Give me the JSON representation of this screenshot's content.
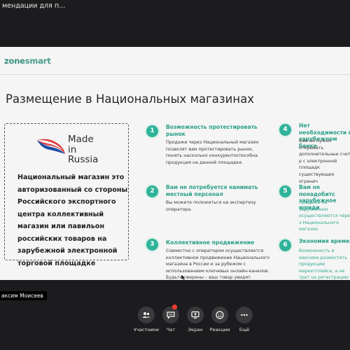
{
  "window": {
    "title": "мендации для п..."
  },
  "slide": {
    "logo": {
      "prefix": "zone",
      "suffix": "smart"
    },
    "headline": "Размещение в Национальных магазинах",
    "made_in_russia": {
      "line1": "Made",
      "line2": "in Russia"
    },
    "national_store_text": "Национальный магазин это авторизованный со стороны Российского экспортного центра коллективный магазин или павильон российских товаров на зарубежной электронной торговой площадке",
    "features": [
      {
        "num": "1",
        "title": "Возможность протестировать рынок",
        "text": "Продажи через Национальный магазин позволят вам протестировать рынок, понять насколько конкурентоспособна продукция на данной площадке."
      },
      {
        "num": "2",
        "title": "Вам не потребуется нанимать местный персонал",
        "text": "Вы можете положиться на экспертизу оператора."
      },
      {
        "num": "3",
        "title": "Коллективное продвижение",
        "text": "Совместно с оператором осуществляется коллективное продвижение Национального магазина в России и за рубежом с использованием ключевых онлайн-каналов. Будьте уверены – ваш товар увидят."
      },
      {
        "num": "4",
        "title": "Нет необходимости в зарубежном банке",
        "text": "Вам не нужно открывать дополнительные счета р с электронной площадк существующих огранич"
      },
      {
        "num": "5",
        "title": "Вам не понадобитс зарубежное юриди",
        "text": "Продажи на зарубежном осуществляются через з Национального магазин"
      },
      {
        "num": "6",
        "title": "Экономия времен",
        "text": "Возможность в максима разместить продукцию маркетплейсе, а не трат на регистрацию собстве подготовку необходим"
      }
    ]
  },
  "participant": {
    "name": "аксим Моисеев"
  },
  "toolbar": [
    {
      "label": "Участники",
      "icon": "people-icon"
    },
    {
      "label": "Чат",
      "icon": "chat-icon"
    },
    {
      "label": "Экран",
      "icon": "screen-share-icon"
    },
    {
      "label": "Реакции",
      "icon": "smile-icon"
    },
    {
      "label": "Ещё",
      "icon": "more-icon"
    }
  ],
  "colors": {
    "accent": "#2fb39a",
    "background": "#1c1c1e",
    "slide_bg": "#f4f5f4"
  }
}
